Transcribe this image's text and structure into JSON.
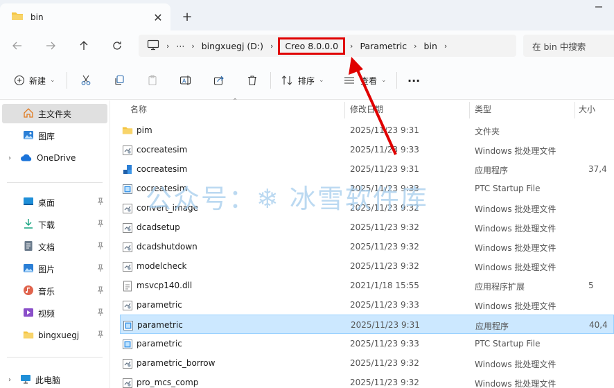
{
  "window": {
    "tab_title": "bin",
    "new_tab": "+",
    "close_tab": "✕"
  },
  "address": {
    "more": "···",
    "crumbs": [
      "bingxuegj (D:)",
      "Creo 8.0.0.0",
      "Parametric",
      "bin"
    ],
    "search_placeholder": "在 bin 中搜索"
  },
  "toolbar": {
    "new_label": "新建",
    "sort_label": "排序",
    "view_label": "查看",
    "more_label": "···"
  },
  "sidebar": {
    "home": "主文件夹",
    "gallery": "图库",
    "onedrive": "OneDrive",
    "quick": [
      "桌面",
      "下载",
      "文档",
      "图片",
      "音乐",
      "视频",
      "bingxuegj"
    ],
    "this_pc": "此电脑"
  },
  "columns": {
    "name": "名称",
    "date": "修改日期",
    "type": "类型",
    "size": "大小"
  },
  "files": [
    {
      "name": "pim",
      "date": "2025/11/23 9:31",
      "type": "文件夹",
      "size": "",
      "icon": "folder"
    },
    {
      "name": "cocreatesim",
      "date": "2025/11/23 9:33",
      "type": "Windows 批处理文件",
      "size": "",
      "icon": "bat"
    },
    {
      "name": "cocreatesim",
      "date": "2025/11/23 9:31",
      "type": "应用程序",
      "size": "37,4",
      "icon": "app"
    },
    {
      "name": "cocreatesim",
      "date": "2025/11/23 9:33",
      "type": "PTC Startup File",
      "size": "",
      "icon": "psf"
    },
    {
      "name": "convert_image",
      "date": "2025/11/23 9:32",
      "type": "Windows 批处理文件",
      "size": "",
      "icon": "bat"
    },
    {
      "name": "dcadsetup",
      "date": "2025/11/23 9:32",
      "type": "Windows 批处理文件",
      "size": "",
      "icon": "bat"
    },
    {
      "name": "dcadshutdown",
      "date": "2025/11/23 9:32",
      "type": "Windows 批处理文件",
      "size": "",
      "icon": "bat"
    },
    {
      "name": "modelcheck",
      "date": "2025/11/23 9:32",
      "type": "Windows 批处理文件",
      "size": "",
      "icon": "bat"
    },
    {
      "name": "msvcp140.dll",
      "date": "2021/1/18 15:55",
      "type": "应用程序扩展",
      "size": "5",
      "icon": "dll"
    },
    {
      "name": "parametric",
      "date": "2025/11/23 9:33",
      "type": "Windows 批处理文件",
      "size": "",
      "icon": "bat"
    },
    {
      "name": "parametric",
      "date": "2025/11/23 9:31",
      "type": "应用程序",
      "size": "40,4",
      "icon": "psf",
      "selected": true
    },
    {
      "name": "parametric",
      "date": "2025/11/23 9:33",
      "type": "PTC Startup File",
      "size": "",
      "icon": "psf"
    },
    {
      "name": "parametric_borrow",
      "date": "2025/11/23 9:32",
      "type": "Windows 批处理文件",
      "size": "",
      "icon": "bat"
    },
    {
      "name": "pro_mcs_comp",
      "date": "2025/11/23 9:32",
      "type": "Windows 批处理文件",
      "size": "",
      "icon": "bat"
    }
  ],
  "watermark": "公众号：❄ 冰雪软件库",
  "colors": {
    "highlight_box": "#e00000",
    "selection": "#cce8ff",
    "folder": "#f4c542",
    "accent": "#2b7fd6"
  }
}
